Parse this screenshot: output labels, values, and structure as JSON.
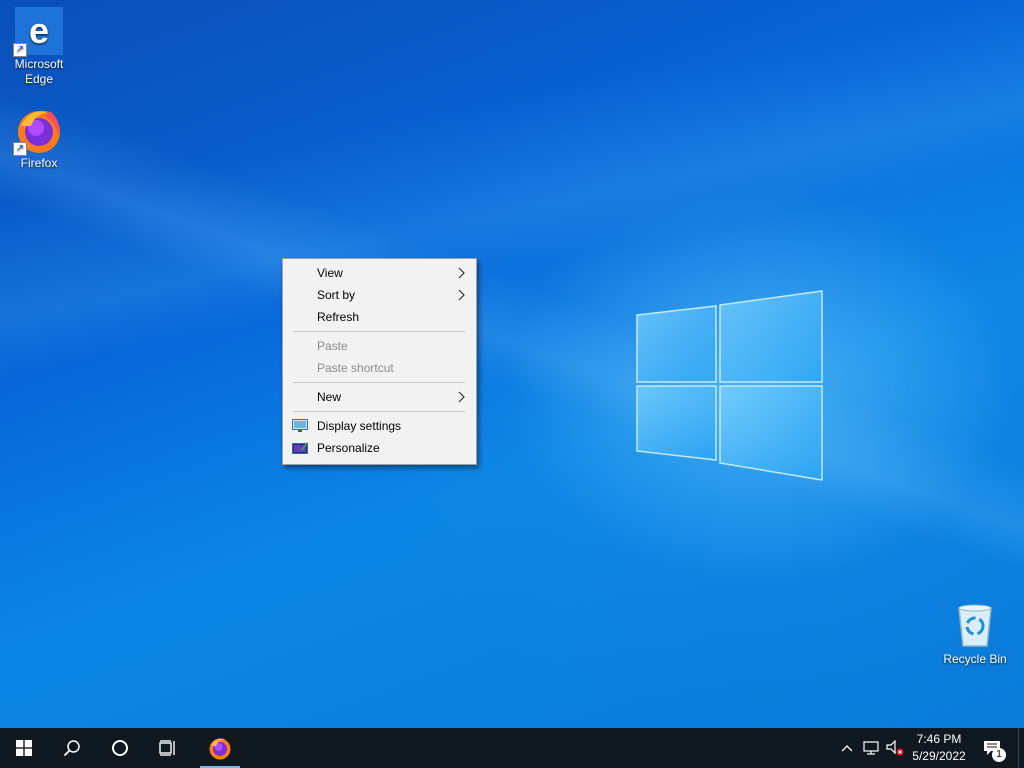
{
  "desktop": {
    "icons": [
      {
        "label_line1": "Microsoft",
        "label_line2": "Edge",
        "icon": "edge-icon"
      },
      {
        "label_line1": "Firefox",
        "icon": "firefox-icon"
      },
      {
        "label_line1": "Recycle Bin",
        "icon": "recycle-bin-icon"
      }
    ]
  },
  "context_menu": {
    "items": [
      {
        "label": "View",
        "submenu": true,
        "enabled": true
      },
      {
        "label": "Sort by",
        "submenu": true,
        "enabled": true
      },
      {
        "label": "Refresh",
        "submenu": false,
        "enabled": true
      },
      {
        "label": "Paste",
        "submenu": false,
        "enabled": false
      },
      {
        "label": "Paste shortcut",
        "submenu": false,
        "enabled": false
      },
      {
        "label": "New",
        "submenu": true,
        "enabled": true
      },
      {
        "label": "Display settings",
        "submenu": false,
        "enabled": true,
        "icon": "display-icon"
      },
      {
        "label": "Personalize",
        "submenu": false,
        "enabled": true,
        "icon": "personalize-icon"
      }
    ]
  },
  "taskbar": {
    "buttons": [
      "start-icon",
      "search-icon",
      "cortana-icon",
      "task-view-icon",
      "firefox-icon"
    ],
    "tray": [
      "chevron-up-icon",
      "network-icon",
      "volume-muted-icon"
    ],
    "clock": {
      "time": "7:46 PM",
      "date": "5/29/2022"
    },
    "notification_count": "1"
  },
  "colors": {
    "taskbar": "#101820",
    "menu_bg": "#f2f2f2",
    "disabled_text": "#8c8c8c",
    "active_indicator": "#76b9ed"
  }
}
